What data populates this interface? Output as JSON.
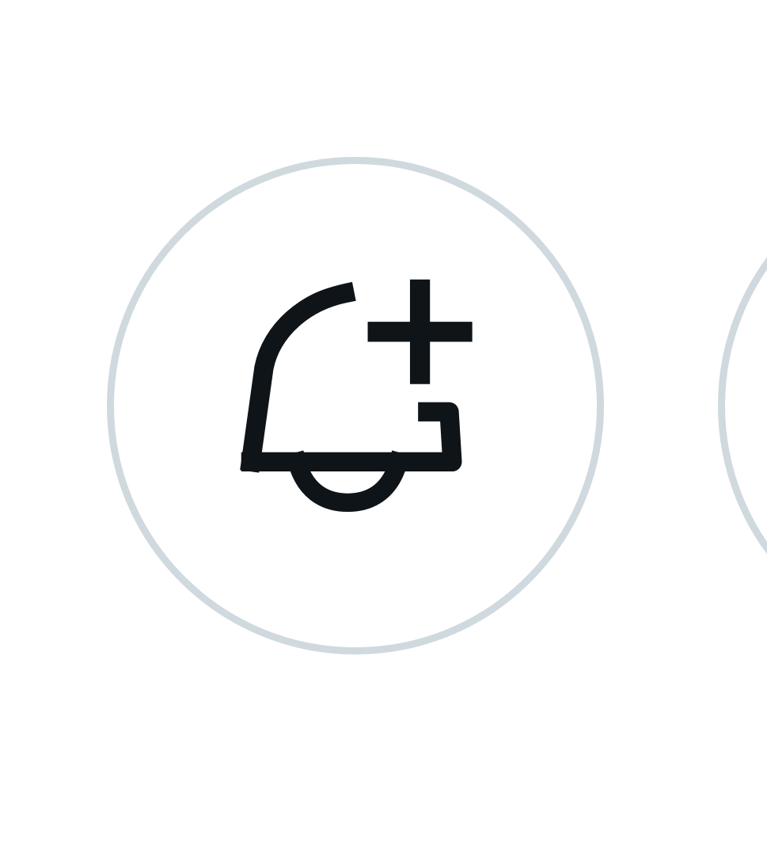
{
  "bell_button": {
    "icon": "bell-plus-icon",
    "label": ""
  },
  "adjacent_button": {
    "icon": "",
    "label": ""
  },
  "colors": {
    "background": "#ffffff",
    "circle_border": "#cfd9de",
    "icon_stroke": "#0f1419"
  }
}
